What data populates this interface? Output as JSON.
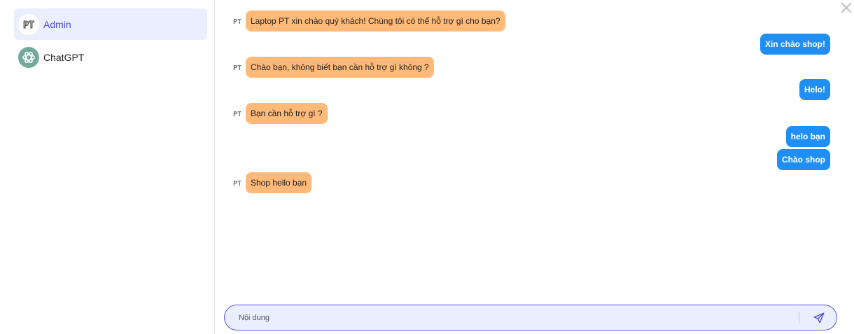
{
  "sidebar": {
    "contacts": [
      {
        "name": "Admin",
        "avatar_text": "PT",
        "active": true
      },
      {
        "name": "ChatGPT",
        "avatar_icon": "openai-logo-icon",
        "active": false
      }
    ]
  },
  "window": {
    "close_icon": "close-icon"
  },
  "messages": [
    {
      "from": "shop",
      "avatar_text": "PT",
      "text": "Laptop PT xin chào quý khách! Chúng tôi có thể hỗ trợ gì cho bạn?"
    },
    {
      "from": "user",
      "text": "Xin chào shop!"
    },
    {
      "from": "shop",
      "avatar_text": "PT",
      "text": "Chào bạn, không biết bạn cần hỗ trợ gì không ?"
    },
    {
      "from": "user",
      "text": "Helo!"
    },
    {
      "from": "shop",
      "avatar_text": "PT",
      "text": "Bạn cần hỗ trợ gì ?"
    },
    {
      "from": "user",
      "text": "helo bạn"
    },
    {
      "from": "user",
      "text": "Chào shop"
    },
    {
      "from": "shop",
      "avatar_text": "PT",
      "text": "Shop hello bạn"
    }
  ],
  "composer": {
    "placeholder": "Nội dung",
    "value": "",
    "send_icon": "send-icon"
  },
  "colors": {
    "incoming_bubble": "#ffb978",
    "outgoing_bubble": "#1f8ff5",
    "active_contact_bg": "#eaefff",
    "accent": "#4a4ad1"
  }
}
